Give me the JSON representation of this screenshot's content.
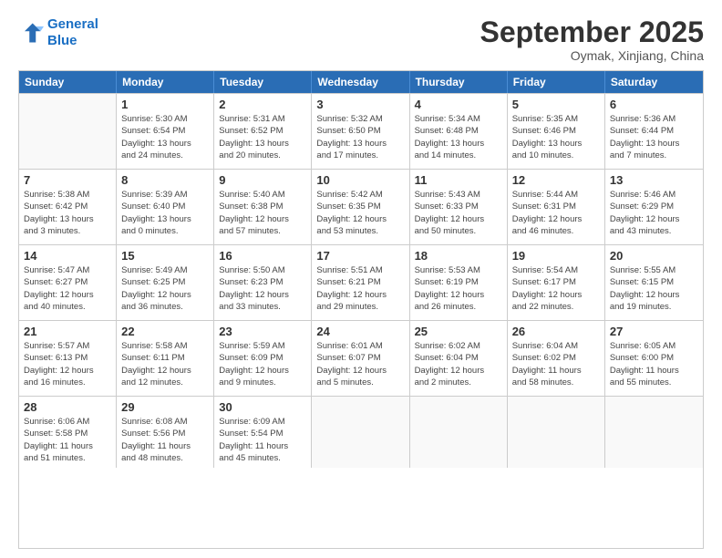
{
  "logo": {
    "line1": "General",
    "line2": "Blue"
  },
  "title": "September 2025",
  "location": "Oymak, Xinjiang, China",
  "days_header": [
    "Sunday",
    "Monday",
    "Tuesday",
    "Wednesday",
    "Thursday",
    "Friday",
    "Saturday"
  ],
  "weeks": [
    [
      {
        "day": "",
        "info": ""
      },
      {
        "day": "1",
        "info": "Sunrise: 5:30 AM\nSunset: 6:54 PM\nDaylight: 13 hours\nand 24 minutes."
      },
      {
        "day": "2",
        "info": "Sunrise: 5:31 AM\nSunset: 6:52 PM\nDaylight: 13 hours\nand 20 minutes."
      },
      {
        "day": "3",
        "info": "Sunrise: 5:32 AM\nSunset: 6:50 PM\nDaylight: 13 hours\nand 17 minutes."
      },
      {
        "day": "4",
        "info": "Sunrise: 5:34 AM\nSunset: 6:48 PM\nDaylight: 13 hours\nand 14 minutes."
      },
      {
        "day": "5",
        "info": "Sunrise: 5:35 AM\nSunset: 6:46 PM\nDaylight: 13 hours\nand 10 minutes."
      },
      {
        "day": "6",
        "info": "Sunrise: 5:36 AM\nSunset: 6:44 PM\nDaylight: 13 hours\nand 7 minutes."
      }
    ],
    [
      {
        "day": "7",
        "info": "Sunrise: 5:38 AM\nSunset: 6:42 PM\nDaylight: 13 hours\nand 3 minutes."
      },
      {
        "day": "8",
        "info": "Sunrise: 5:39 AM\nSunset: 6:40 PM\nDaylight: 13 hours\nand 0 minutes."
      },
      {
        "day": "9",
        "info": "Sunrise: 5:40 AM\nSunset: 6:38 PM\nDaylight: 12 hours\nand 57 minutes."
      },
      {
        "day": "10",
        "info": "Sunrise: 5:42 AM\nSunset: 6:35 PM\nDaylight: 12 hours\nand 53 minutes."
      },
      {
        "day": "11",
        "info": "Sunrise: 5:43 AM\nSunset: 6:33 PM\nDaylight: 12 hours\nand 50 minutes."
      },
      {
        "day": "12",
        "info": "Sunrise: 5:44 AM\nSunset: 6:31 PM\nDaylight: 12 hours\nand 46 minutes."
      },
      {
        "day": "13",
        "info": "Sunrise: 5:46 AM\nSunset: 6:29 PM\nDaylight: 12 hours\nand 43 minutes."
      }
    ],
    [
      {
        "day": "14",
        "info": "Sunrise: 5:47 AM\nSunset: 6:27 PM\nDaylight: 12 hours\nand 40 minutes."
      },
      {
        "day": "15",
        "info": "Sunrise: 5:49 AM\nSunset: 6:25 PM\nDaylight: 12 hours\nand 36 minutes."
      },
      {
        "day": "16",
        "info": "Sunrise: 5:50 AM\nSunset: 6:23 PM\nDaylight: 12 hours\nand 33 minutes."
      },
      {
        "day": "17",
        "info": "Sunrise: 5:51 AM\nSunset: 6:21 PM\nDaylight: 12 hours\nand 29 minutes."
      },
      {
        "day": "18",
        "info": "Sunrise: 5:53 AM\nSunset: 6:19 PM\nDaylight: 12 hours\nand 26 minutes."
      },
      {
        "day": "19",
        "info": "Sunrise: 5:54 AM\nSunset: 6:17 PM\nDaylight: 12 hours\nand 22 minutes."
      },
      {
        "day": "20",
        "info": "Sunrise: 5:55 AM\nSunset: 6:15 PM\nDaylight: 12 hours\nand 19 minutes."
      }
    ],
    [
      {
        "day": "21",
        "info": "Sunrise: 5:57 AM\nSunset: 6:13 PM\nDaylight: 12 hours\nand 16 minutes."
      },
      {
        "day": "22",
        "info": "Sunrise: 5:58 AM\nSunset: 6:11 PM\nDaylight: 12 hours\nand 12 minutes."
      },
      {
        "day": "23",
        "info": "Sunrise: 5:59 AM\nSunset: 6:09 PM\nDaylight: 12 hours\nand 9 minutes."
      },
      {
        "day": "24",
        "info": "Sunrise: 6:01 AM\nSunset: 6:07 PM\nDaylight: 12 hours\nand 5 minutes."
      },
      {
        "day": "25",
        "info": "Sunrise: 6:02 AM\nSunset: 6:04 PM\nDaylight: 12 hours\nand 2 minutes."
      },
      {
        "day": "26",
        "info": "Sunrise: 6:04 AM\nSunset: 6:02 PM\nDaylight: 11 hours\nand 58 minutes."
      },
      {
        "day": "27",
        "info": "Sunrise: 6:05 AM\nSunset: 6:00 PM\nDaylight: 11 hours\nand 55 minutes."
      }
    ],
    [
      {
        "day": "28",
        "info": "Sunrise: 6:06 AM\nSunset: 5:58 PM\nDaylight: 11 hours\nand 51 minutes."
      },
      {
        "day": "29",
        "info": "Sunrise: 6:08 AM\nSunset: 5:56 PM\nDaylight: 11 hours\nand 48 minutes."
      },
      {
        "day": "30",
        "info": "Sunrise: 6:09 AM\nSunset: 5:54 PM\nDaylight: 11 hours\nand 45 minutes."
      },
      {
        "day": "",
        "info": ""
      },
      {
        "day": "",
        "info": ""
      },
      {
        "day": "",
        "info": ""
      },
      {
        "day": "",
        "info": ""
      }
    ]
  ]
}
